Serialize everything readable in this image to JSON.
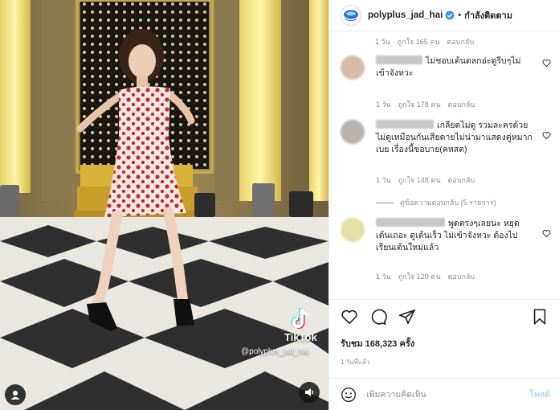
{
  "post": {
    "username": "polyplus_jad_hai",
    "follow_status": "กำลังติดตาม",
    "separator": "•",
    "likes_label": "รับชม 168,323 ครั้ง",
    "posted_time": "1 วันที่แล้ว"
  },
  "video": {
    "tiktok_label": "TikTok",
    "tiktok_handle": "@polyplus_jad_hai"
  },
  "comments_top_meta": {
    "time": "1 วัน",
    "likes": "ถูกใจ 165 คน",
    "reply": "ตอบกลับ"
  },
  "comments": [
    {
      "text": "ไม่ชอบเต้นตลกอ่ะดูรีบๆไม่เข้าจังหวะ",
      "time": "1 วัน",
      "likes": "ถูกใจ 178 คน",
      "reply": "ตอบกลับ"
    },
    {
      "text": "เกลียดไม่ดู รวมละครด้วย ไม่ดูเหมือนกันเสียดายไม่น่ามาแสดงคู่หมากเบย เรื่องนี้ขอบาย(คหสต)",
      "time": "1 วัน",
      "likes": "ถูกใจ 148 คน",
      "reply": "ตอบกลับ"
    },
    {
      "text": "พูดตรงๆเลยนะ หยุดเต้นเถอะ ดูเต้นเร็ว ไม่เข้าจังหวะ ต้องไปเรียนเต้นใหม่แล้ว",
      "time": "1 วัน",
      "likes": "ถูกใจ 120 คน",
      "reply": "ตอบกลับ"
    }
  ],
  "replies_link": "ดูข้อความตอบกลับ (5 รายการ)",
  "comment_box": {
    "placeholder": "เพิ่มความคิดเห็น",
    "post_label": "โพสต์"
  },
  "icons": {
    "heart": "heart-icon",
    "comment": "comment-icon",
    "share": "share-icon",
    "bookmark": "bookmark-icon",
    "emoji": "emoji-icon",
    "verified": "verified-badge-icon",
    "user": "user-icon",
    "volume": "volume-icon"
  },
  "colors": {
    "verified": "#3897f0",
    "post_button": "#b3dbff",
    "muted_text": "#8e8e8e"
  }
}
